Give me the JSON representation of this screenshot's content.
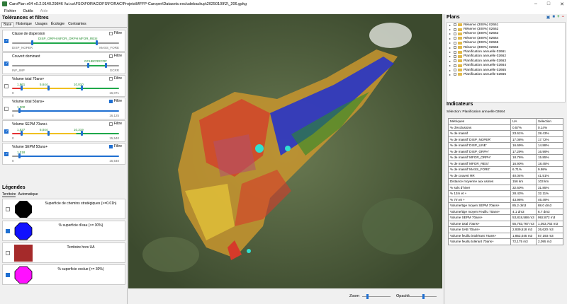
{
  "window": {
    "title": "CaroPlan x64 v0.2.9140.29846   \\\\ui.ca\\FSO\\FORAC\\DFS\\FORAC\\Projets\\MFFP-Caroper\\Datasets.excludebackup\\20250109\\2\\_206.gpkg"
  },
  "menu": [
    "Fichier",
    "Outils",
    "Aide"
  ],
  "left": {
    "title": "Tolérances et filtres",
    "tabs": [
      "Base",
      "Historique",
      "Usages",
      "Écologie",
      "Contraintes"
    ],
    "filter_label": "Filtre",
    "filters": [
      {
        "name": "Classe de dispersion",
        "checked": true,
        "filter": false,
        "min": "DISP_NOPER",
        "max": "MASS_FORE",
        "center": "DISP_ORPH MFOR_ORPH MFOR_RESI",
        "track": "#1fa84a"
      },
      {
        "name": "Couvert dominant",
        "checked": true,
        "filter": false,
        "min": "INF_IMP",
        "max": "GCRR",
        "center": "GCHBCRRCRF",
        "track": "#1fa84a"
      },
      {
        "name": "Volume total 70ans+",
        "checked": false,
        "filter": false,
        "min": "0",
        "max": "16,071",
        "v1": "1,961",
        "v2": "5,644",
        "v3": "10,810"
      },
      {
        "name": "Volume total 50ans+",
        "checked": false,
        "filter": true,
        "min": "0",
        "max": "16,125",
        "v1": "1,000"
      },
      {
        "name": "Volume SEPM 70ans+",
        "checked": true,
        "filter": false,
        "min": "0",
        "max": "15,540",
        "v1": "1,527",
        "v2": "5,044",
        "v3": "10,319"
      },
      {
        "name": "Volume SEPM 50ans+",
        "checked": true,
        "filter": true,
        "min": "0",
        "max": "15,540",
        "v1": "1,018"
      }
    ],
    "legend_title": "Légendes",
    "legend_tabs": [
      "Territoire",
      "Automatique"
    ],
    "legend_items": [
      {
        "label": "Superficie de chemins stratégiques (>=0.01h)",
        "checked": false,
        "color": "#000000",
        "shape": "octagon"
      },
      {
        "label": "% superficie d'eau (>= 30%)",
        "checked": true,
        "color": "#1010ff",
        "shape": "octagon"
      },
      {
        "label": "Territoire hors UA",
        "checked": false,
        "color": "#a52a2a",
        "shape": "square"
      },
      {
        "label": "% superficie exclue (>= 30%)",
        "checked": true,
        "color": "#ff10ff",
        "shape": "octagon"
      }
    ]
  },
  "status": {
    "zoom_label": "Zoom",
    "opacity_label": "Opacité"
  },
  "right": {
    "plans_title": "Plans",
    "plans": [
      "Réserve (300%) 02661",
      "Réserve (300%) 02662",
      "Réserve (300%) 02663",
      "Réserve (300%) 02664",
      "Réserve (300%) 02665",
      "Réserve (300%) 02666",
      "Planification annuelle 02661",
      "Planification annuelle 02662",
      "Planification annuelle 02663",
      "Planification annuelle 02664",
      "Planification annuelle 02665",
      "Planification annuelle 02666"
    ],
    "indicators_title": "Indicateurs",
    "selection_text": "Sélection: Planification annuelle 02664",
    "table_headers": [
      "Métriques",
      "UA",
      "Sélection"
    ],
    "rows": [
      [
        "% d'exclusions",
        "0.57%",
        "0.14%"
      ],
      [
        "% de massif",
        "23.61%",
        "28.43%"
      ],
      [
        "% de massif 'DISP_NOPER'",
        "17.08%",
        "17.72%"
      ],
      [
        "% de massif 'DISP_LINE'",
        "16.69%",
        "14.88%"
      ],
      [
        "% de massif 'DISP_ORPH'",
        "17.29%",
        "16.99%"
      ],
      [
        "% de massif 'MFOR_ORPH'",
        "18.76%",
        "15.85%"
      ],
      [
        "% de massif 'MFOR_RESI'",
        "16.90%",
        "18.45%"
      ],
      [
        "% de massif 'MASS_FORE'",
        "6.71%",
        "9.98%"
      ],
      [
        "% de couvert RR",
        "40.04%",
        "41.51%"
      ],
      [
        "Distance moyenne aux usines",
        "156 km",
        "103 km"
      ],
      [
        "% sols d'hiver",
        "32.60%",
        "31.85%"
      ],
      [
        "% 12m et +",
        "28.43%",
        "32.11%"
      ],
      [
        "% 7m et +",
        "43.96%",
        "46.49%"
      ],
      [
        "Volume/tige moyen SEPM 70ans+",
        "85.2 dm3",
        "88.0 dm3"
      ],
      [
        "Volume/tige moyen Feuillu 70ans+",
        "4.1 dm3",
        "6.7 dm3"
      ],
      [
        "Volume SEPM 70ans+",
        "53,818,588 m3",
        "992,872 m3"
      ],
      [
        "Volume total 70ans+",
        "55,783,767 m3",
        "1,053,762 m3"
      ],
      [
        "Volume SAB 70ans+",
        "2,939,518 m3",
        "26,620 m3"
      ],
      [
        "Volume feuillu intolérant 70ans+",
        "1,852,045 m3",
        "57,193 m3"
      ],
      [
        "Volume feuillu tolérant 70ans+",
        "72,175 m3",
        "2,095 m3"
      ]
    ]
  }
}
